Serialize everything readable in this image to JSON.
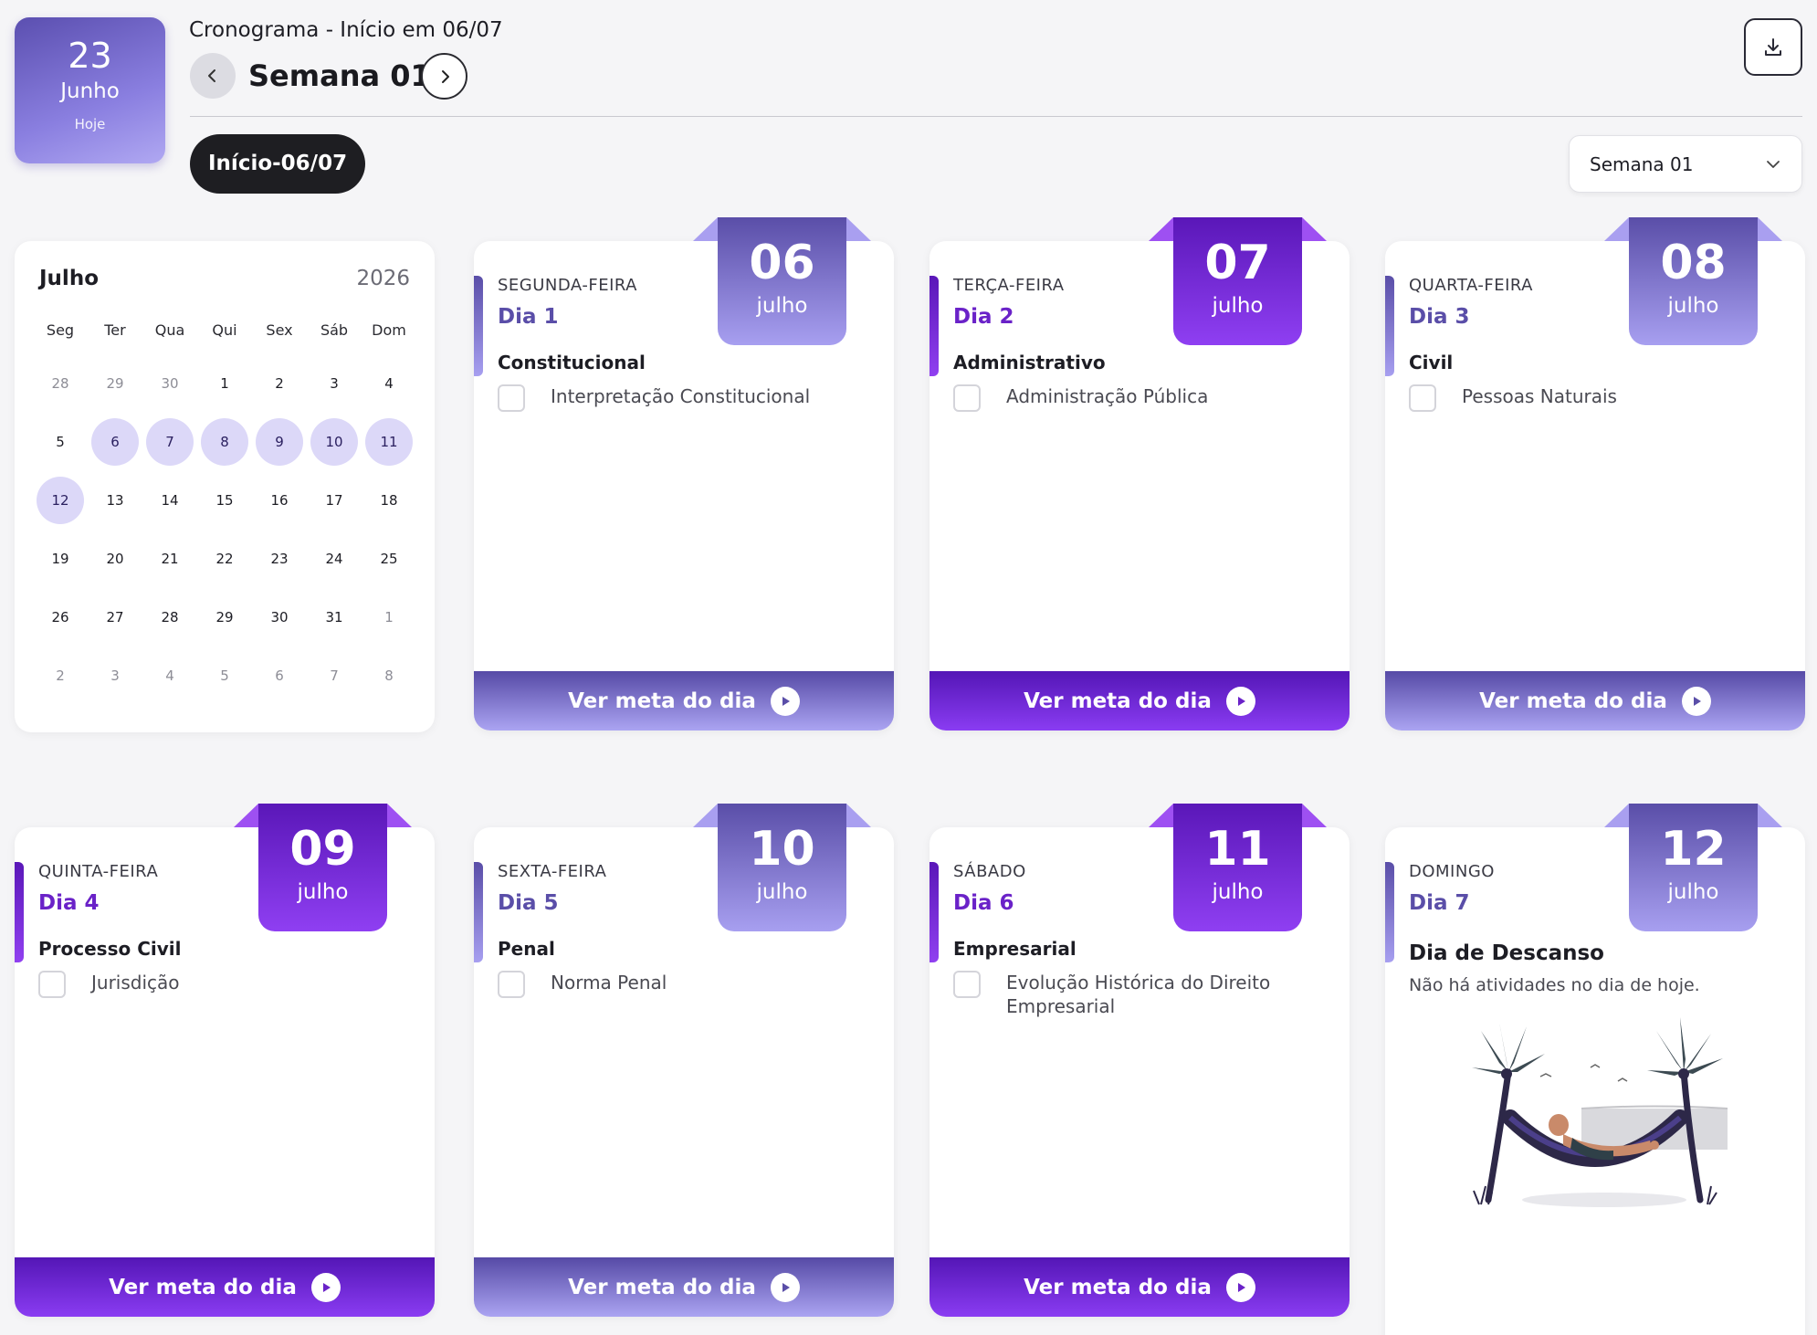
{
  "today": {
    "day": "23",
    "month": "Junho",
    "label": "Hoje"
  },
  "header": {
    "title": "Cronograma - Início em 06/07",
    "week_title": "Semana 01",
    "inicio_pill": "Início-06/07",
    "week_select": "Semana 01"
  },
  "mini_calendar": {
    "month": "Julho",
    "year": "2026",
    "weekdays": [
      "Seg",
      "Ter",
      "Qua",
      "Qui",
      "Sex",
      "Sáb",
      "Dom"
    ],
    "days": [
      {
        "n": "28",
        "muted": true
      },
      {
        "n": "29",
        "muted": true
      },
      {
        "n": "30",
        "muted": true
      },
      {
        "n": "1"
      },
      {
        "n": "2"
      },
      {
        "n": "3"
      },
      {
        "n": "4"
      },
      {
        "n": "5"
      },
      {
        "n": "6",
        "hl": true
      },
      {
        "n": "7",
        "hl": true
      },
      {
        "n": "8",
        "hl": true
      },
      {
        "n": "9",
        "hl": true
      },
      {
        "n": "10",
        "hl": true
      },
      {
        "n": "11",
        "hl": true
      },
      {
        "n": "12",
        "hl": true
      },
      {
        "n": "13"
      },
      {
        "n": "14"
      },
      {
        "n": "15"
      },
      {
        "n": "16"
      },
      {
        "n": "17"
      },
      {
        "n": "18"
      },
      {
        "n": "19"
      },
      {
        "n": "20"
      },
      {
        "n": "21"
      },
      {
        "n": "22"
      },
      {
        "n": "23"
      },
      {
        "n": "24"
      },
      {
        "n": "25"
      },
      {
        "n": "26"
      },
      {
        "n": "27"
      },
      {
        "n": "28"
      },
      {
        "n": "29"
      },
      {
        "n": "30"
      },
      {
        "n": "31"
      },
      {
        "n": "1",
        "muted": true
      },
      {
        "n": "2",
        "muted": true
      },
      {
        "n": "3",
        "muted": true
      },
      {
        "n": "4",
        "muted": true
      },
      {
        "n": "5",
        "muted": true
      },
      {
        "n": "6",
        "muted": true
      },
      {
        "n": "7",
        "muted": true
      },
      {
        "n": "8",
        "muted": true
      }
    ]
  },
  "cta_label": "Ver meta do dia",
  "cards": [
    {
      "weekday": "SEGUNDA-FEIRA",
      "dia": "Dia 1",
      "subject": "Constitucional",
      "topic": "Interpretação Constitucional",
      "day": "06",
      "month": "julho",
      "variant": "light"
    },
    {
      "weekday": "TERÇA-FEIRA",
      "dia": "Dia 2",
      "subject": "Administrativo",
      "topic": "Administração Pública",
      "day": "07",
      "month": "julho",
      "variant": "dark"
    },
    {
      "weekday": "QUARTA-FEIRA",
      "dia": "Dia 3",
      "subject": "Civil",
      "topic": "Pessoas Naturais",
      "day": "08",
      "month": "julho",
      "variant": "light"
    },
    {
      "weekday": "QUINTA-FEIRA",
      "dia": "Dia 4",
      "subject": "Processo Civil",
      "topic": "Jurisdição",
      "day": "09",
      "month": "julho",
      "variant": "dark"
    },
    {
      "weekday": "SEXTA-FEIRA",
      "dia": "Dia 5",
      "subject": "Penal",
      "topic": "Norma Penal",
      "day": "10",
      "month": "julho",
      "variant": "light"
    },
    {
      "weekday": "SÁBADO",
      "dia": "Dia 6",
      "subject": "Empresarial",
      "topic": "Evolução Histórica do Direito Empresarial",
      "day": "11",
      "month": "julho",
      "variant": "dark"
    }
  ],
  "rest_card": {
    "weekday": "DOMINGO",
    "dia": "Dia 7",
    "day": "12",
    "month": "julho",
    "variant": "light",
    "title": "Dia de Descanso",
    "text": "Não há atividades no dia de hoje."
  },
  "icons": {
    "prev": "chevron-left-icon",
    "next": "chevron-right-icon",
    "download": "download-icon",
    "select": "chevron-down-icon",
    "play": "play-icon"
  }
}
